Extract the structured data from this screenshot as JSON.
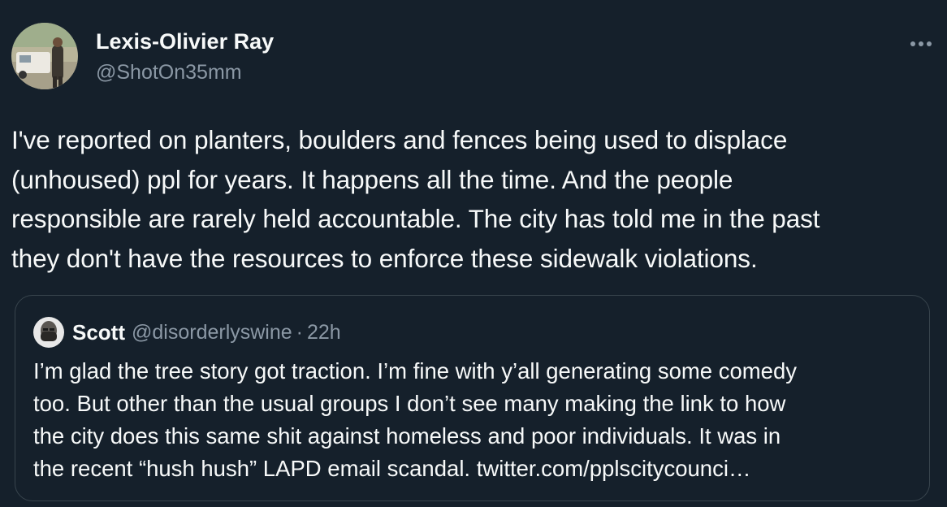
{
  "author": {
    "display_name": "Lexis-Olivier Ray",
    "handle": "@ShotOn35mm"
  },
  "more_icon": "more-horizontal-icon",
  "tweet": {
    "lines": [
      "I've reported on planters, boulders and fences being used to displace",
      "(unhoused) ppl for years. It happens all the time. And the people",
      "responsible are rarely held accountable. The city has told me in the past",
      "they don't have the resources to enforce these sidewalk violations."
    ]
  },
  "quoted_tweet": {
    "display_name": "Scott",
    "handle": "@disorderlyswine",
    "separator": "·",
    "time": "22h",
    "lines": [
      "I’m glad the tree story got traction. I’m fine with y’all generating some comedy",
      "too. But other than the usual groups I don’t see many making the link to how",
      "the city does this same shit against homeless and poor individuals. It was in",
      "the recent “hush hush” LAPD email scandal. twitter.com/pplscitycounci…"
    ]
  },
  "colors": {
    "background": "#15202b",
    "text_primary": "#f7f9f9",
    "text_secondary": "#8b98a5",
    "border": "#38444d"
  }
}
